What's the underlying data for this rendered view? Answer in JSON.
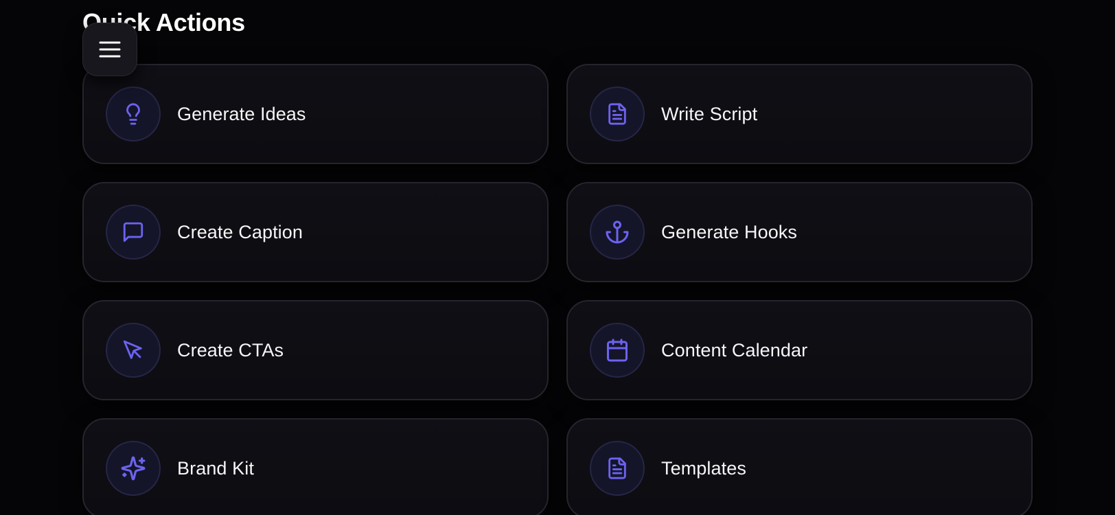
{
  "section": {
    "title": "Quick Actions"
  },
  "menu": {
    "icon": "hamburger-menu-icon"
  },
  "theme": {
    "accent": "#6c63f0",
    "background": "#050507",
    "card_background": "#0e0e14",
    "card_border": "#25252d"
  },
  "actions": [
    {
      "label": "Generate Ideas",
      "icon": "lightbulb-icon"
    },
    {
      "label": "Write Script",
      "icon": "document-icon"
    },
    {
      "label": "Create Caption",
      "icon": "message-square-icon"
    },
    {
      "label": "Generate Hooks",
      "icon": "anchor-icon"
    },
    {
      "label": "Create CTAs",
      "icon": "mouse-pointer-icon"
    },
    {
      "label": "Content Calendar",
      "icon": "calendar-icon"
    },
    {
      "label": "Brand Kit",
      "icon": "sparkles-icon"
    },
    {
      "label": "Templates",
      "icon": "document-icon"
    }
  ]
}
